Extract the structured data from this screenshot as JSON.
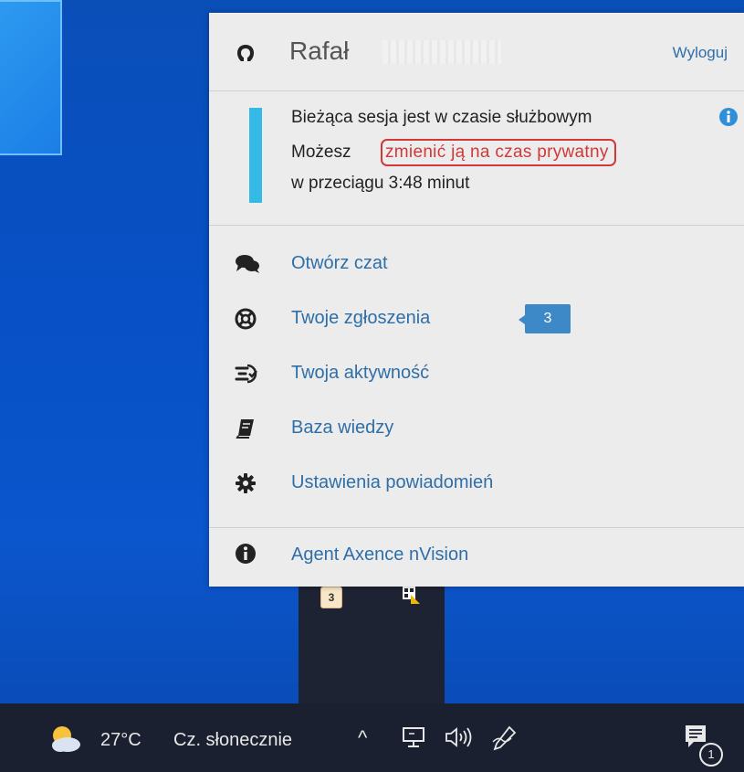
{
  "header": {
    "user_name": "Rafał",
    "logout_label": "Wyloguj"
  },
  "session": {
    "line1": "Bieżąca sesja jest w czasie służbowym",
    "line2_prefix": "Możesz",
    "change_link": "zmienić ją na czas prywatny",
    "line3": "w przeciągu 3:48 minut"
  },
  "menu": {
    "items": [
      {
        "label": "Otwórz czat",
        "icon": "chat-icon"
      },
      {
        "label": "Twoje zgłoszenia",
        "icon": "lifebuoy-icon",
        "badge": "3"
      },
      {
        "label": "Twoja aktywność",
        "icon": "activity-icon"
      },
      {
        "label": "Baza wiedzy",
        "icon": "book-icon"
      },
      {
        "label": "Ustawienia powiadomień",
        "icon": "gear-icon"
      }
    ],
    "footer": {
      "label": "Agent Axence nVision",
      "icon": "info-icon"
    }
  },
  "tray_overflow": {
    "badge_icon_value": "3"
  },
  "taskbar": {
    "weather_temp": "27°C",
    "weather_desc": "Cz. słonecznie",
    "chevron": "^",
    "notification_count": "1"
  },
  "colors": {
    "link": "#2f6fa8",
    "accent_bar": "#35b9e6",
    "highlight": "#d23838",
    "badge": "#3d89c8"
  }
}
